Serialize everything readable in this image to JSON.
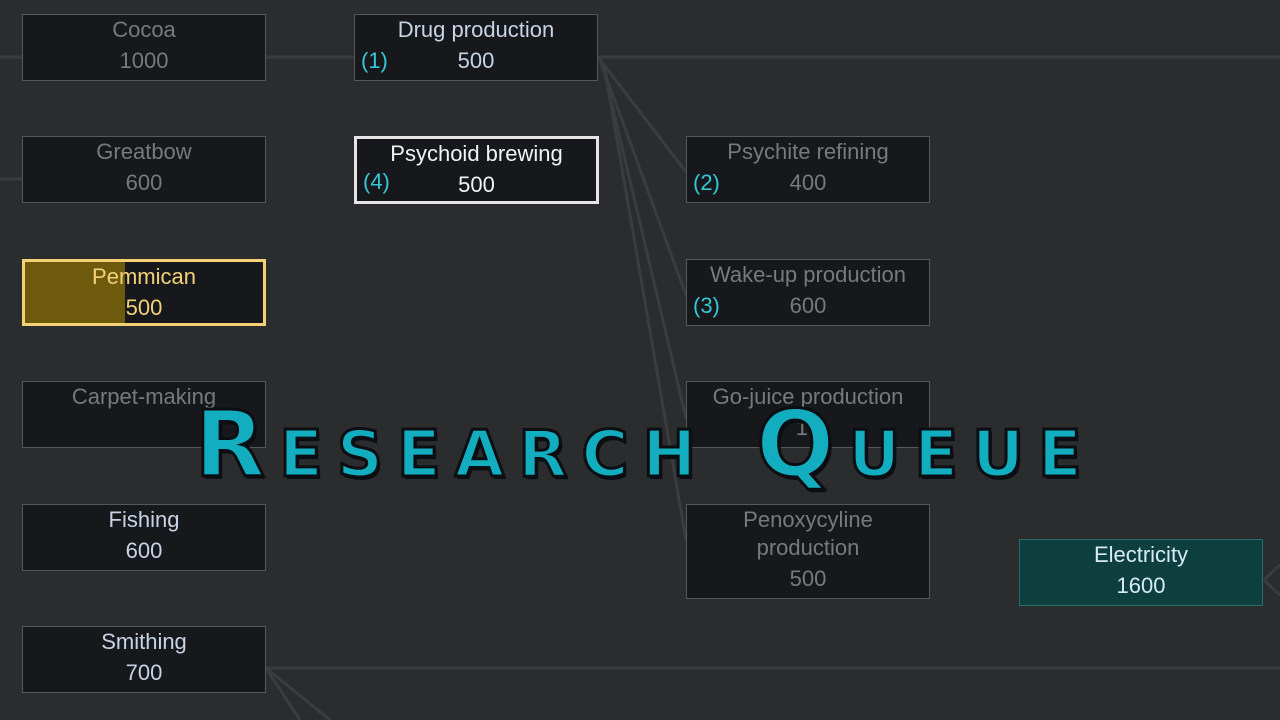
{
  "banner": {
    "title": "Research Queue"
  },
  "colors": {
    "background": "#2b2c2e",
    "node_fill": "#16181c",
    "node_border": "#55575b",
    "queue_number": "#34c8d6",
    "active_border": "#f4d175",
    "active_progress": "#6d5a0c",
    "completed_fill": "#0d3f3f",
    "banner_text": "#12aebf"
  },
  "projects": [
    {
      "id": "cocoa",
      "title": "Cocoa",
      "cost": "1000",
      "queue": "",
      "state": "faded"
    },
    {
      "id": "greatbow",
      "title": "Greatbow",
      "cost": "600",
      "queue": "",
      "state": "faded"
    },
    {
      "id": "pemmican",
      "title": "Pemmican",
      "cost": "500",
      "queue": "",
      "state": "active",
      "progress": 0.42
    },
    {
      "id": "carpet-making",
      "title": "Carpet-making",
      "cost": "",
      "queue": "",
      "state": "faded"
    },
    {
      "id": "fishing",
      "title": "Fishing",
      "cost": "600",
      "queue": "",
      "state": "avail"
    },
    {
      "id": "smithing",
      "title": "Smithing",
      "cost": "700",
      "queue": "",
      "state": "avail"
    },
    {
      "id": "drug-production",
      "title": "Drug production",
      "cost": "500",
      "queue": "(1)",
      "state": "avail"
    },
    {
      "id": "psychoid-brewing",
      "title": "Psychoid brewing",
      "cost": "500",
      "queue": "(4)",
      "state": "selected"
    },
    {
      "id": "psychite-refining",
      "title": "Psychite refining",
      "cost": "400",
      "queue": "(2)",
      "state": "faded"
    },
    {
      "id": "wake-up-production",
      "title": "Wake-up production",
      "cost": "600",
      "queue": "(3)",
      "state": "faded"
    },
    {
      "id": "go-juice-production",
      "title": "Go-juice production",
      "cost": "10",
      "queue": "",
      "state": "faded"
    },
    {
      "id": "penoxycyline-production",
      "title": "Penoxycyline production",
      "cost": "500",
      "queue": "",
      "state": "faded"
    },
    {
      "id": "electricity",
      "title": "Electricity",
      "cost": "1600",
      "queue": "",
      "state": "done"
    }
  ]
}
